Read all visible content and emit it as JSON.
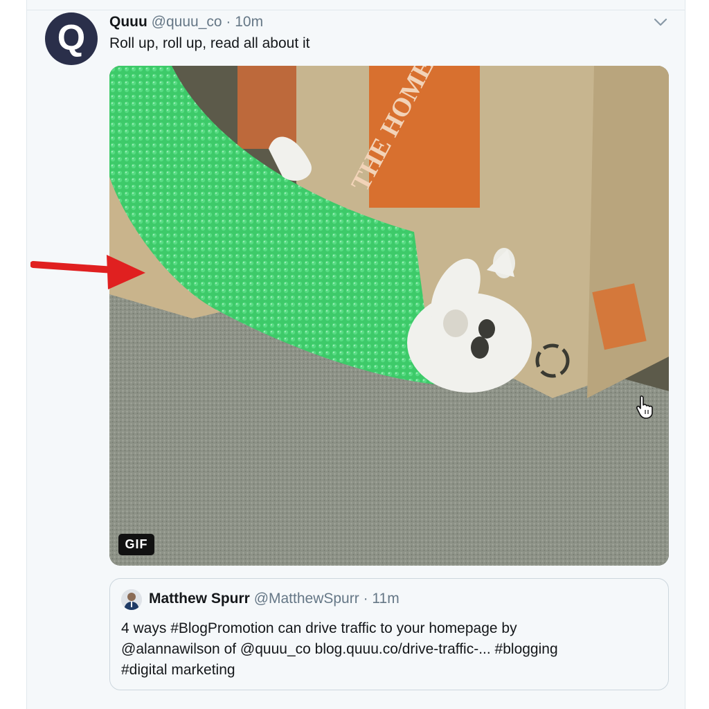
{
  "tweet": {
    "avatar_letter": "Q",
    "name": "Quuu",
    "handle": "@quuu_co",
    "separator": " · ",
    "time": "10m",
    "text": "Roll up, roll up, read all about it",
    "media_badge": "GIF",
    "menu_icon": "chevron-down-icon"
  },
  "quoted_tweet": {
    "name": "Matthew Spurr",
    "handle": "@MatthewSpurr",
    "separator": " · ",
    "time": "11m",
    "lines": [
      "4 ways #BlogPromotion can drive traffic to your homepage by",
      "@alannawilson of @quuu_co blog.quuu.co/drive-traffic-...  #blogging",
      "#digital marketing"
    ]
  },
  "annotation": {
    "arrow_color": "#e02020",
    "arrow_icon": "arrow-right-icon",
    "cursor_icon": "hand-pointer-icon"
  },
  "colors": {
    "background": "#f5f8fa",
    "secondary_text": "#657786",
    "avatar": "#2a2f4a"
  }
}
